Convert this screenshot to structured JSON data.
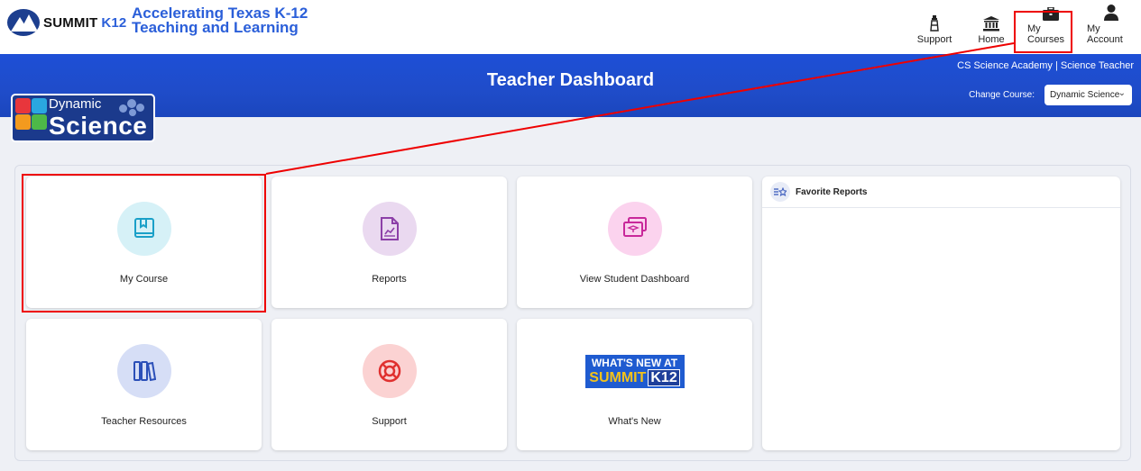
{
  "brand": {
    "name": "SUMMIT",
    "k12": "K12",
    "tagline_1": "Accelerating Texas K-12",
    "tagline_2": "Teaching and Learning"
  },
  "nav": [
    {
      "id": "support",
      "label": "Support",
      "icon": "lighthouse-icon"
    },
    {
      "id": "home",
      "label": "Home",
      "icon": "building-columns-icon"
    },
    {
      "id": "courses",
      "label": "My Courses",
      "icon": "briefcase-icon"
    },
    {
      "id": "account",
      "label": "My Account",
      "icon": "user-icon"
    }
  ],
  "banner": {
    "title": "Teacher Dashboard",
    "school": "CS Science Academy | Science Teacher",
    "change_course_label": "Change Course:",
    "selected_course": "Dynamic Science"
  },
  "course_logo": {
    "line1": "Dynamic",
    "line2": "Science"
  },
  "tiles": [
    {
      "label": "My Course",
      "icon": "book-icon",
      "color": "#d6f1f7"
    },
    {
      "label": "Reports",
      "icon": "report-icon",
      "color": "#ead9f0"
    },
    {
      "label": "View Student Dashboard",
      "icon": "student-dashboard-icon",
      "color": "#fbd3ee"
    },
    {
      "label": "Teacher Resources",
      "icon": "books-icon",
      "color": "#d6def6"
    },
    {
      "label": "Support",
      "icon": "lifebuoy-icon",
      "color": "#fbd2d2"
    },
    {
      "label": "What's New",
      "icon": "whats-new-banner",
      "banner_line1": "WHAT'S NEW AT",
      "banner_line2": "SUMMIT",
      "banner_k12": "K12"
    }
  ],
  "favorites": {
    "title": "Favorite Reports",
    "icon": "star-list-icon"
  },
  "colors": {
    "banner": "#1e4fd6",
    "accent": "#2b5fd9",
    "highlight": "#e00000"
  }
}
